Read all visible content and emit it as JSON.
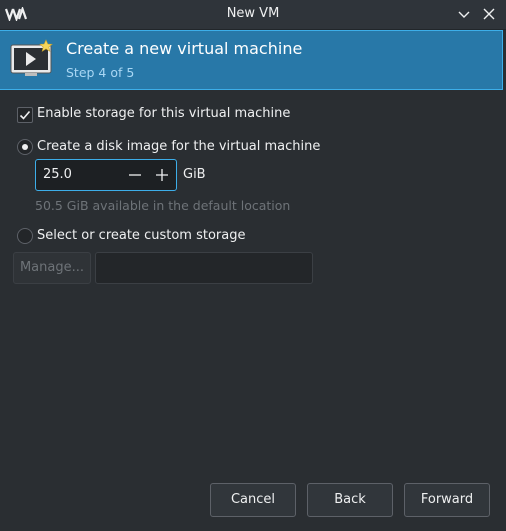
{
  "window": {
    "title": "New VM"
  },
  "header": {
    "title": "Create a new virtual machine",
    "step": "Step 4 of 5"
  },
  "storage": {
    "enable_label": "Enable storage for this virtual machine",
    "enable_checked": true,
    "create_disk_label": "Create a disk image for the virtual machine",
    "create_disk_selected": true,
    "disk_size_value": "25.0",
    "disk_size_unit": "GiB",
    "available_text": "50.5 GiB available in the default location",
    "custom_label": "Select or create custom storage",
    "custom_selected": false,
    "manage_label": "Manage...",
    "custom_path_value": ""
  },
  "footer": {
    "cancel_label": "Cancel",
    "back_label": "Back",
    "forward_label": "Forward"
  },
  "colors": {
    "accent": "#3daee9",
    "banner": "#2878a8",
    "background": "#2a2e32"
  }
}
